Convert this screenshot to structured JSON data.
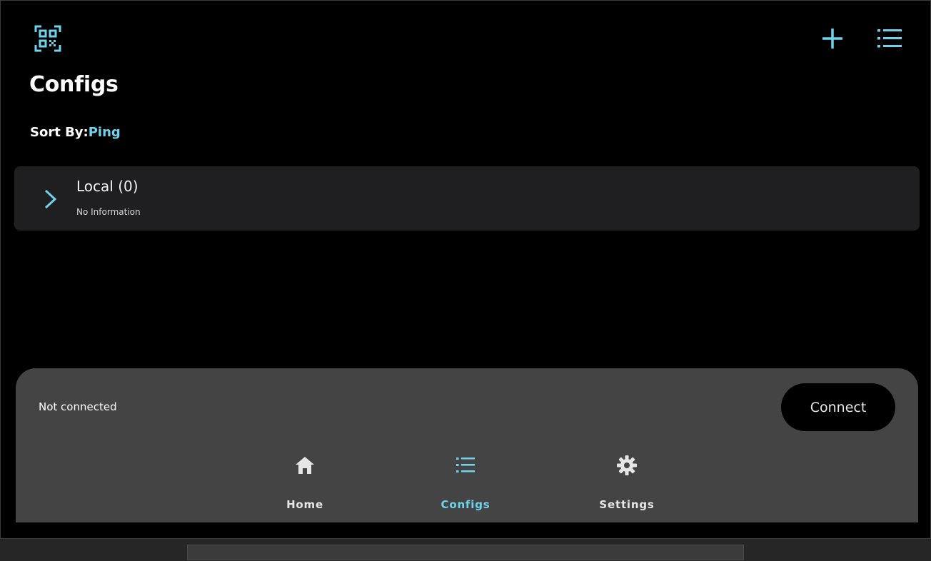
{
  "header": {
    "title": "Configs",
    "icons": {
      "scan": "qr-scan-icon",
      "add": "plus-icon",
      "menu": "list-menu-icon"
    }
  },
  "sort": {
    "label": "Sort By:",
    "value": "Ping"
  },
  "groups": [
    {
      "title": "Local (0)",
      "subtitle": "No Information",
      "icon": "chevron-right-icon"
    }
  ],
  "connection": {
    "status": "Not connected",
    "button_label": "Connect"
  },
  "bottom_nav": {
    "items": [
      {
        "label": "Home",
        "icon": "home-icon",
        "active": false
      },
      {
        "label": "Configs",
        "icon": "list-icon",
        "active": true
      },
      {
        "label": "Settings",
        "icon": "gear-icon",
        "active": false
      }
    ]
  },
  "colors": {
    "accent": "#6fd3ec",
    "background": "#000000",
    "card": "#1f1f22",
    "panel": "#444444"
  }
}
